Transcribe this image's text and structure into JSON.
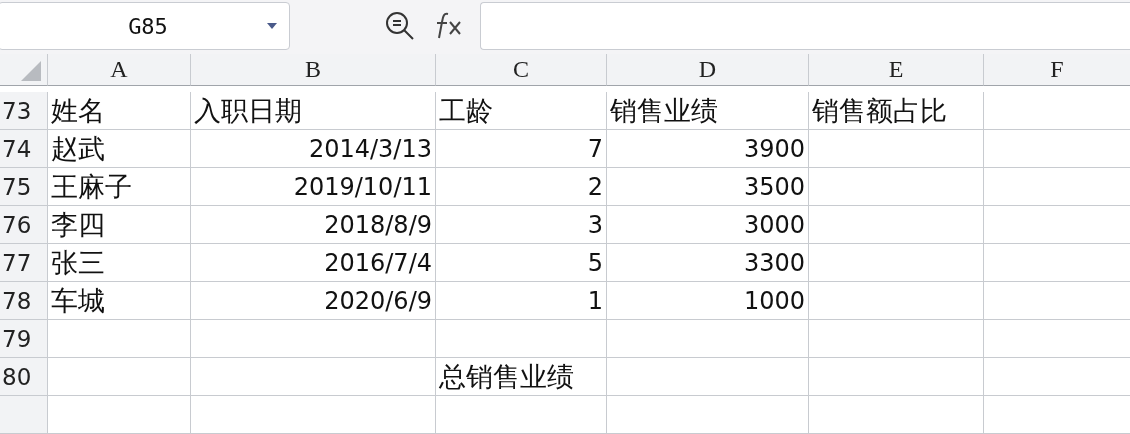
{
  "name_box": {
    "value": "G85"
  },
  "columns": [
    "A",
    "B",
    "C",
    "D",
    "E",
    "F"
  ],
  "rows": [
    {
      "number": "73",
      "cells": [
        {
          "kind": "text",
          "text": "姓名"
        },
        {
          "kind": "text",
          "text": "入职日期"
        },
        {
          "kind": "text",
          "text": "工龄"
        },
        {
          "kind": "text",
          "text": "销售业绩"
        },
        {
          "kind": "text",
          "text": "销售额占比"
        },
        {
          "kind": "empty"
        }
      ]
    },
    {
      "number": "74",
      "cells": [
        {
          "kind": "text",
          "text": "赵武"
        },
        {
          "kind": "number",
          "text": "2014/3/13"
        },
        {
          "kind": "number",
          "text": "7"
        },
        {
          "kind": "number",
          "text": "3900"
        },
        {
          "kind": "empty"
        },
        {
          "kind": "empty"
        }
      ]
    },
    {
      "number": "75",
      "cells": [
        {
          "kind": "text",
          "text": "王麻子"
        },
        {
          "kind": "number",
          "text": "2019/10/11"
        },
        {
          "kind": "number",
          "text": "2"
        },
        {
          "kind": "number",
          "text": "3500"
        },
        {
          "kind": "empty"
        },
        {
          "kind": "empty"
        }
      ]
    },
    {
      "number": "76",
      "cells": [
        {
          "kind": "text",
          "text": "李四"
        },
        {
          "kind": "number",
          "text": "2018/8/9"
        },
        {
          "kind": "number",
          "text": "3"
        },
        {
          "kind": "number",
          "text": "3000"
        },
        {
          "kind": "empty"
        },
        {
          "kind": "empty"
        }
      ]
    },
    {
      "number": "77",
      "cells": [
        {
          "kind": "text",
          "text": "张三"
        },
        {
          "kind": "number",
          "text": "2016/7/4"
        },
        {
          "kind": "number",
          "text": "5"
        },
        {
          "kind": "number",
          "text": "3300"
        },
        {
          "kind": "empty"
        },
        {
          "kind": "empty"
        }
      ]
    },
    {
      "number": "78",
      "cells": [
        {
          "kind": "text",
          "text": "车城"
        },
        {
          "kind": "number",
          "text": "2020/6/9"
        },
        {
          "kind": "number",
          "text": "1"
        },
        {
          "kind": "number",
          "text": "1000"
        },
        {
          "kind": "empty"
        },
        {
          "kind": "empty"
        }
      ]
    },
    {
      "number": "79",
      "cells": [
        {
          "kind": "empty"
        },
        {
          "kind": "empty"
        },
        {
          "kind": "empty"
        },
        {
          "kind": "empty"
        },
        {
          "kind": "empty"
        },
        {
          "kind": "empty"
        }
      ]
    },
    {
      "number": "80",
      "cells": [
        {
          "kind": "empty"
        },
        {
          "kind": "empty"
        },
        {
          "kind": "text",
          "text": "总销售业绩"
        },
        {
          "kind": "empty"
        },
        {
          "kind": "empty"
        },
        {
          "kind": "empty"
        }
      ]
    }
  ]
}
